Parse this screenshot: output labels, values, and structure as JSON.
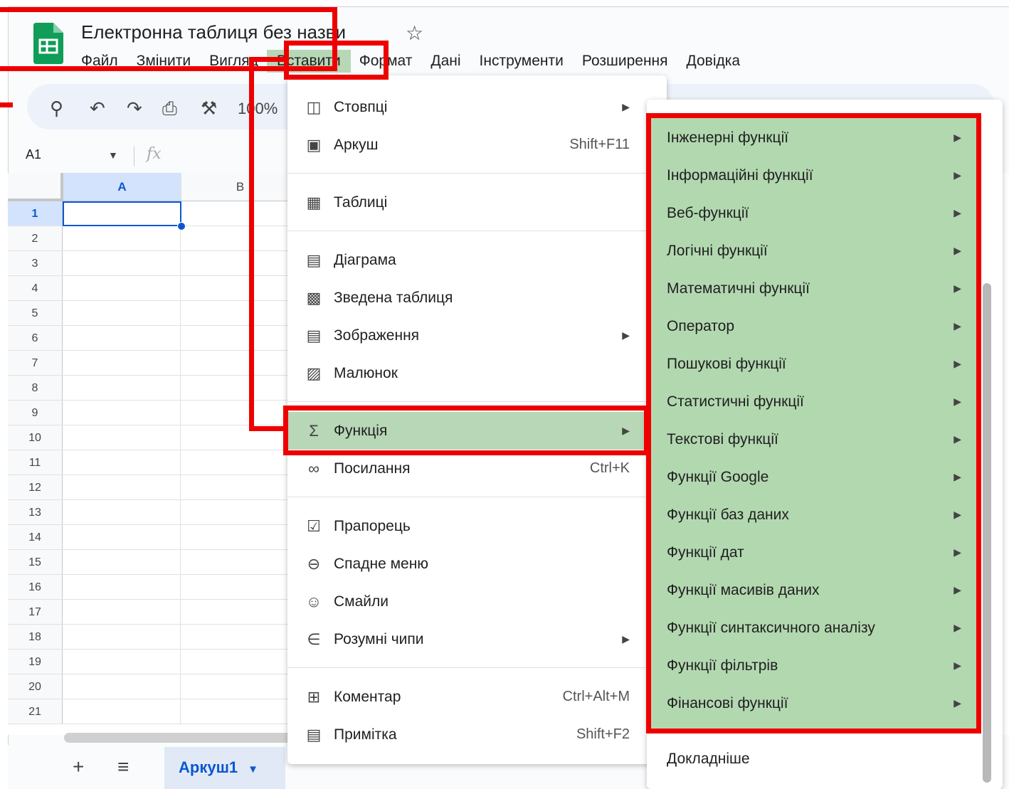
{
  "doc": {
    "title": "Електронна таблиця без назви"
  },
  "menubar": [
    "Файл",
    "Змінити",
    "Вигляд",
    "Вставити",
    "Формат",
    "Дані",
    "Інструменти",
    "Розширення",
    "Довідка"
  ],
  "toolbar": {
    "zoom": "100%"
  },
  "namebox": "A1",
  "formula_icon": "fx",
  "grid": {
    "columns": [
      "A",
      "B"
    ],
    "rows": [
      "1",
      "2",
      "3",
      "4",
      "5",
      "6",
      "7",
      "8",
      "9",
      "10",
      "11",
      "12",
      "13",
      "14",
      "15",
      "16",
      "17",
      "18",
      "19",
      "20",
      "21"
    ]
  },
  "sheet": {
    "tab_name": "Аркуш1"
  },
  "insert_menu": {
    "items": [
      {
        "label": "Стовпці",
        "icon": "columns-icon",
        "arrow": true
      },
      {
        "label": "Аркуш",
        "icon": "sheet-icon",
        "shortcut": "Shift+F11"
      },
      {
        "label": "Таблиці",
        "icon": "table-icon"
      },
      {
        "label": "Діаграма",
        "icon": "chart-icon"
      },
      {
        "label": "Зведена таблиця",
        "icon": "pivot-table-icon"
      },
      {
        "label": "Зображення",
        "icon": "image-icon",
        "arrow": true
      },
      {
        "label": "Малюнок",
        "icon": "drawing-icon"
      },
      {
        "label": "Функція",
        "icon": "sigma-icon",
        "arrow": true
      },
      {
        "label": "Посилання",
        "icon": "link-icon",
        "shortcut": "Ctrl+K"
      },
      {
        "label": "Прапорець",
        "icon": "checkbox-icon"
      },
      {
        "label": "Спадне меню",
        "icon": "dropdown-icon"
      },
      {
        "label": "Смайли",
        "icon": "emoji-icon"
      },
      {
        "label": "Розумні чипи",
        "icon": "smart-chip-icon",
        "arrow": true
      },
      {
        "label": "Коментар",
        "icon": "comment-icon",
        "shortcut": "Ctrl+Alt+M"
      },
      {
        "label": "Примітка",
        "icon": "note-icon",
        "shortcut": "Shift+F2"
      }
    ]
  },
  "function_menu": {
    "items": [
      "Інженерні функції",
      "Інформаційні функції",
      "Веб-функції",
      "Логічні функції",
      "Математичні функції",
      "Оператор",
      "Пошукові функції",
      "Статистичні функції",
      "Текстові функції",
      "Функції Google",
      "Функції баз даних",
      "Функції дат",
      "Функції масивів даних",
      "Функції синтаксичного аналізу",
      "Функції фільтрів",
      "Фінансові функції"
    ],
    "more": "Докладніше"
  },
  "colors": {
    "highlight": "#b7d7b6",
    "annotation_red": "#ee0000",
    "selection_blue": "#0b57d0"
  }
}
